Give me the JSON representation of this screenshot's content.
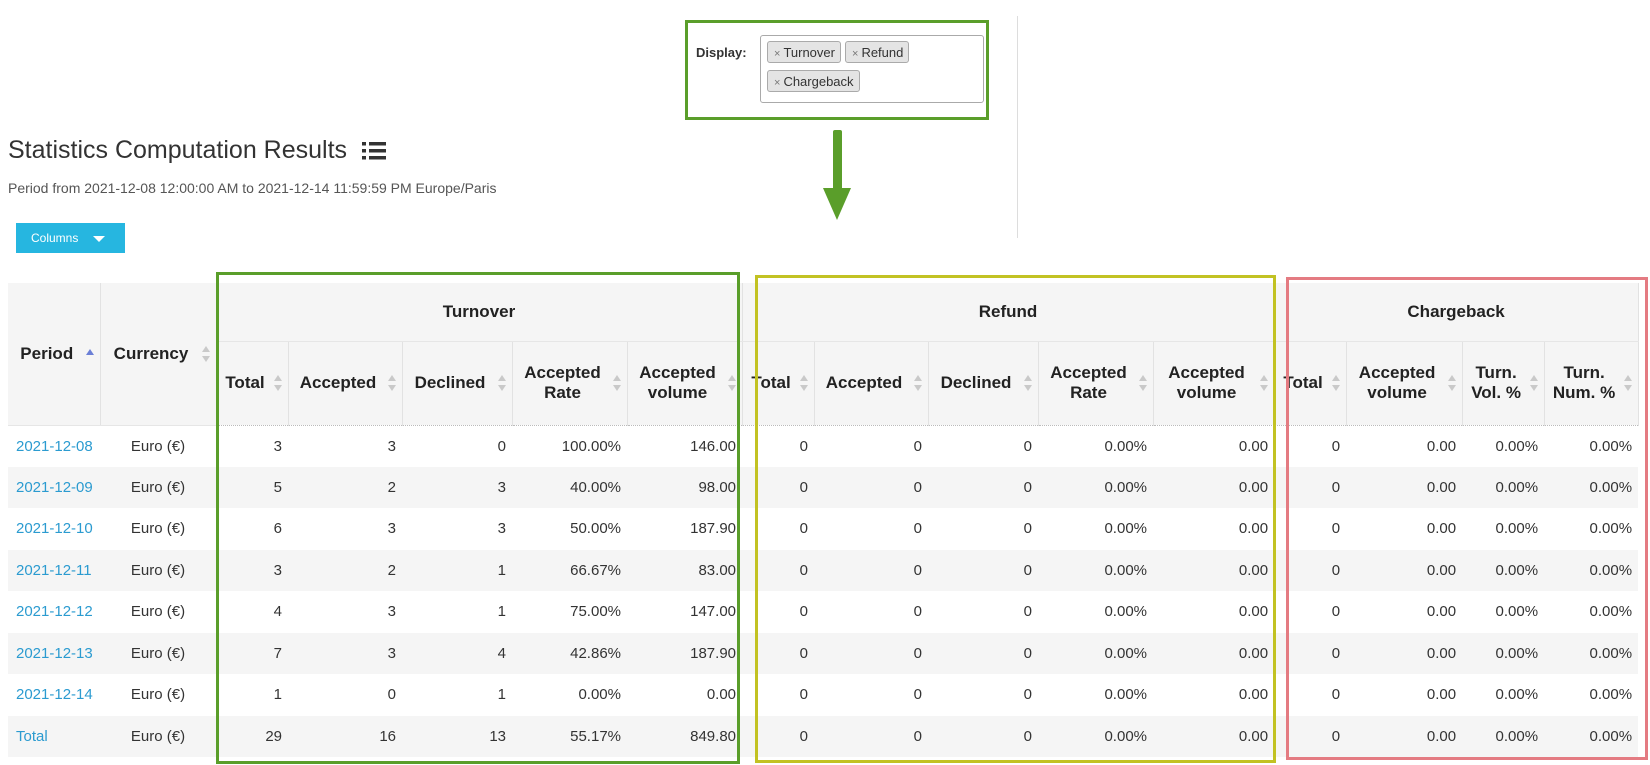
{
  "display": {
    "label": "Display:",
    "tags": [
      {
        "remove": "×",
        "label": "Turnover"
      },
      {
        "remove": "×",
        "label": "Refund"
      },
      {
        "remove": "×",
        "label": "Chargeback"
      }
    ]
  },
  "page": {
    "title": "Statistics Computation Results",
    "period_text": "Period from 2021-12-08 12:00:00 AM to 2021-12-14 11:59:59 PM Europe/Paris",
    "columns_button": "Columns"
  },
  "colors": {
    "turnover_frame": "#5a9e2a",
    "refund_frame": "#c2c223",
    "chargeback_frame": "#e47b82",
    "button": "#26b6e0",
    "link": "#2b9bd0"
  },
  "table": {
    "headers": {
      "period": "Period",
      "currency": "Currency",
      "groups": {
        "turnover": "Turnover",
        "refund": "Refund",
        "chargeback": "Chargeback"
      },
      "turnover": [
        "Total",
        "Accepted",
        "Declined",
        "Accepted Rate",
        "Accepted volume"
      ],
      "refund": [
        "Total",
        "Accepted",
        "Declined",
        "Accepted Rate",
        "Accepted volume"
      ],
      "chargeback": [
        "Total",
        "Accepted volume",
        "Turn. Vol. %",
        "Turn. Num. %"
      ]
    },
    "rows": [
      {
        "period": "2021-12-08",
        "currency": "Euro (€)",
        "t_total": "3",
        "t_accepted": "3",
        "t_declined": "0",
        "t_rate": "100.00%",
        "t_volume": "146.00",
        "r_total": "0",
        "r_accepted": "0",
        "r_declined": "0",
        "r_rate": "0.00%",
        "r_volume": "0.00",
        "c_total": "0",
        "c_volume": "0.00",
        "c_turn_vol": "0.00%",
        "c_turn_num": "0.00%"
      },
      {
        "period": "2021-12-09",
        "currency": "Euro (€)",
        "t_total": "5",
        "t_accepted": "2",
        "t_declined": "3",
        "t_rate": "40.00%",
        "t_volume": "98.00",
        "r_total": "0",
        "r_accepted": "0",
        "r_declined": "0",
        "r_rate": "0.00%",
        "r_volume": "0.00",
        "c_total": "0",
        "c_volume": "0.00",
        "c_turn_vol": "0.00%",
        "c_turn_num": "0.00%"
      },
      {
        "period": "2021-12-10",
        "currency": "Euro (€)",
        "t_total": "6",
        "t_accepted": "3",
        "t_declined": "3",
        "t_rate": "50.00%",
        "t_volume": "187.90",
        "r_total": "0",
        "r_accepted": "0",
        "r_declined": "0",
        "r_rate": "0.00%",
        "r_volume": "0.00",
        "c_total": "0",
        "c_volume": "0.00",
        "c_turn_vol": "0.00%",
        "c_turn_num": "0.00%"
      },
      {
        "period": "2021-12-11",
        "currency": "Euro (€)",
        "t_total": "3",
        "t_accepted": "2",
        "t_declined": "1",
        "t_rate": "66.67%",
        "t_volume": "83.00",
        "r_total": "0",
        "r_accepted": "0",
        "r_declined": "0",
        "r_rate": "0.00%",
        "r_volume": "0.00",
        "c_total": "0",
        "c_volume": "0.00",
        "c_turn_vol": "0.00%",
        "c_turn_num": "0.00%"
      },
      {
        "period": "2021-12-12",
        "currency": "Euro (€)",
        "t_total": "4",
        "t_accepted": "3",
        "t_declined": "1",
        "t_rate": "75.00%",
        "t_volume": "147.00",
        "r_total": "0",
        "r_accepted": "0",
        "r_declined": "0",
        "r_rate": "0.00%",
        "r_volume": "0.00",
        "c_total": "0",
        "c_volume": "0.00",
        "c_turn_vol": "0.00%",
        "c_turn_num": "0.00%"
      },
      {
        "period": "2021-12-13",
        "currency": "Euro (€)",
        "t_total": "7",
        "t_accepted": "3",
        "t_declined": "4",
        "t_rate": "42.86%",
        "t_volume": "187.90",
        "r_total": "0",
        "r_accepted": "0",
        "r_declined": "0",
        "r_rate": "0.00%",
        "r_volume": "0.00",
        "c_total": "0",
        "c_volume": "0.00",
        "c_turn_vol": "0.00%",
        "c_turn_num": "0.00%"
      },
      {
        "period": "2021-12-14",
        "currency": "Euro (€)",
        "t_total": "1",
        "t_accepted": "0",
        "t_declined": "1",
        "t_rate": "0.00%",
        "t_volume": "0.00",
        "r_total": "0",
        "r_accepted": "0",
        "r_declined": "0",
        "r_rate": "0.00%",
        "r_volume": "0.00",
        "c_total": "0",
        "c_volume": "0.00",
        "c_turn_vol": "0.00%",
        "c_turn_num": "0.00%"
      },
      {
        "period": "Total",
        "currency": "Euro (€)",
        "t_total": "29",
        "t_accepted": "16",
        "t_declined": "13",
        "t_rate": "55.17%",
        "t_volume": "849.80",
        "r_total": "0",
        "r_accepted": "0",
        "r_declined": "0",
        "r_rate": "0.00%",
        "r_volume": "0.00",
        "c_total": "0",
        "c_volume": "0.00",
        "c_turn_vol": "0.00%",
        "c_turn_num": "0.00%"
      }
    ]
  }
}
